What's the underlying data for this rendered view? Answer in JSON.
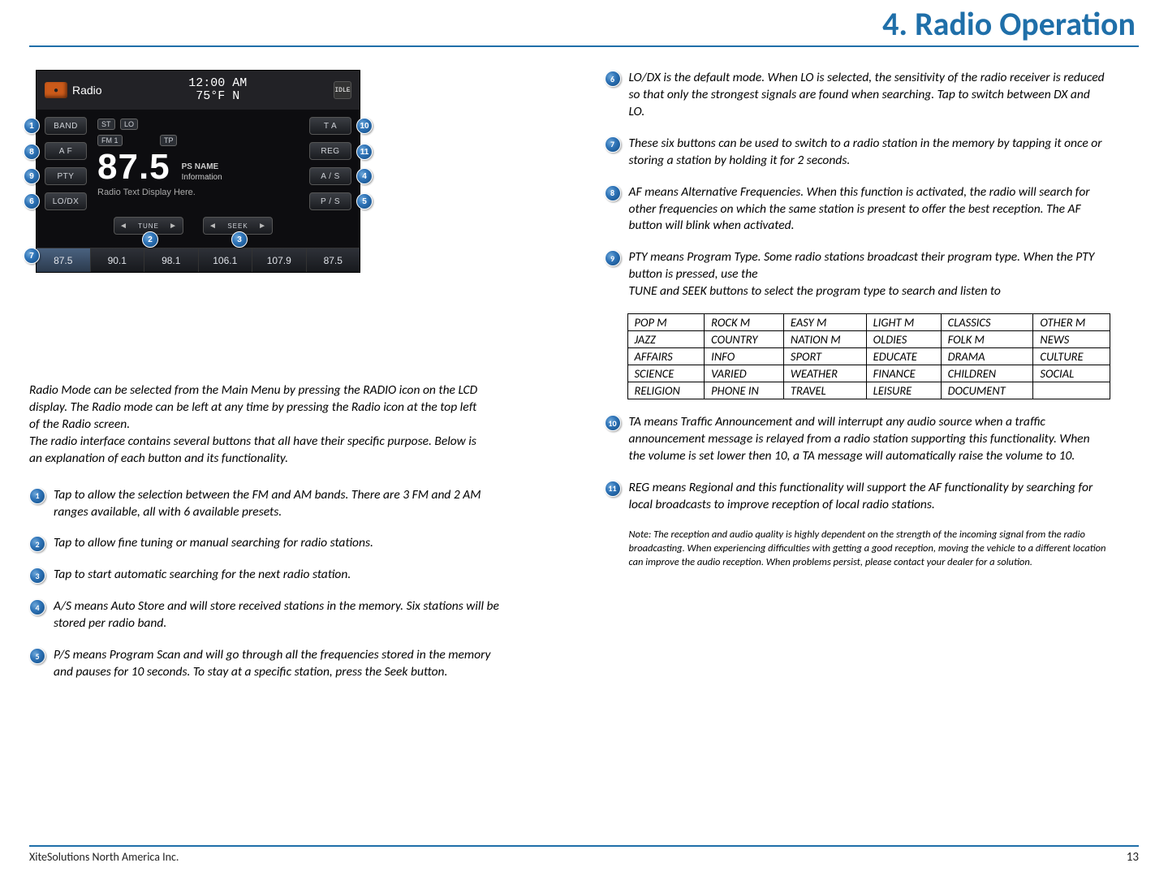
{
  "page": {
    "title": "4. Radio Operation",
    "footer_company": "XiteSolutions North America Inc.",
    "page_number": "13"
  },
  "radio": {
    "label": "Radio",
    "clock": "12:00 AM",
    "temp": "75°F  N",
    "idle": "IDLE",
    "btn_band": "BAND",
    "btn_af": "A F",
    "btn_pty": "PTY",
    "btn_lodx": "LO/DX",
    "btn_ta": "T A",
    "btn_reg": "REG",
    "btn_as": "A / S",
    "btn_ps": "P / S",
    "chip_st": "ST",
    "chip_lo": "LO",
    "chip_fm1": "FM 1",
    "chip_tp": "TP",
    "freq": "87.5",
    "psname_label": "PS NAME",
    "info_label": "Information",
    "radiotext": "Radio Text Display Here.",
    "tune": "TUNE",
    "seek": "SEEK",
    "presets": [
      "87.5",
      "90.1",
      "98.1",
      "106.1",
      "107.9",
      "87.5"
    ]
  },
  "intro": {
    "p1": "Radio Mode can be selected from the Main Menu by pressing the RADIO icon on the LCD display. The Radio mode can be left at any time by pressing the Radio icon at the top left of the Radio screen.",
    "p2": "The radio interface contains several buttons that all have their specific purpose. Below is an explanation of each button and its functionality."
  },
  "items": {
    "i1": "Tap to allow the selection between the FM and AM bands. There are 3 FM and 2 AM ranges available, all with 6 available presets.",
    "i2": "Tap to allow fine tuning or manual searching for radio stations.",
    "i3": "Tap to start automatic searching for the next radio station.",
    "i4": "A/S means Auto Store and will store received stations in the memory. Six stations will be stored per radio band.",
    "i5": "P/S means Program Scan and will go through all the frequencies stored in the memory and pauses for 10 seconds. To stay at a specific station, press the Seek button.",
    "i6": "LO/DX is the default mode. When LO is selected, the sensitivity of the radio receiver is reduced so that only the strongest signals are found when searching. Tap to switch between DX and LO.",
    "i7": "These six buttons can be used to switch to a radio station in the memory by tapping it once or storing a station by holding it for 2 seconds.",
    "i8": "AF means Alternative Frequencies. When this function is activated, the radio will search for other frequencies on which the same station is present to offer the best reception. The AF button will blink when activated.",
    "i9a": "PTY means Program Type. Some radio stations broadcast their program type. When the PTY button is pressed, use the",
    "i9b": "TUNE and SEEK buttons to select the program type to search and listen to",
    "i10": "TA means Traffic Announcement and will interrupt any audio source when a traffic announcement message is relayed from a radio station supporting this functionality. When the volume is set lower then 10, a TA message will automatically raise the volume to 10.",
    "i11": "REG means Regional and this functionality will support the AF functionality by searching for local broadcasts to improve reception of local radio stations."
  },
  "pty_rows": [
    [
      "POP M",
      "ROCK M",
      "EASY M",
      "LIGHT M",
      "CLASSICS",
      "OTHER M"
    ],
    [
      "JAZZ",
      "COUNTRY",
      "NATION M",
      "OLDIES",
      "FOLK M",
      "NEWS"
    ],
    [
      "AFFAIRS",
      "INFO",
      "SPORT",
      "EDUCATE",
      "DRAMA",
      "CULTURE"
    ],
    [
      "SCIENCE",
      "VARIED",
      "WEATHER",
      "FINANCE",
      "CHILDREN",
      "SOCIAL"
    ],
    [
      "RELIGION",
      "PHONE IN",
      "TRAVEL",
      "LEISURE",
      "DOCUMENT",
      ""
    ]
  ],
  "note": "Note: The reception and audio quality is highly dependent on the strength of the incoming signal from the radio broadcasting. When experiencing difficulties with getting a good reception, moving the vehicle to a different location can improve the audio reception. When problems persist, please contact your dealer for a solution."
}
